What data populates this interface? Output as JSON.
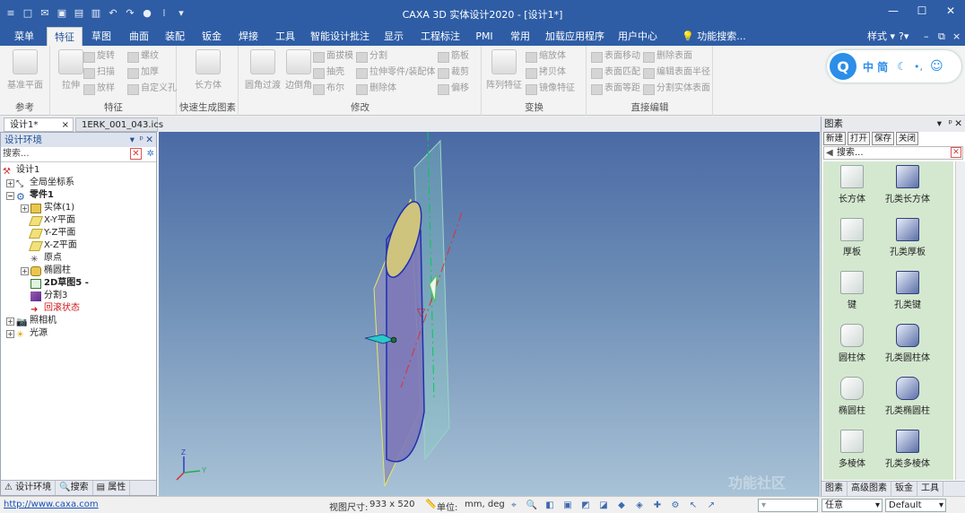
{
  "window": {
    "title": "CAXA 3D 实体设计2020 - [设计1*]"
  },
  "menu": {
    "file_label": "菜单",
    "tabs": [
      "特征",
      "草图",
      "曲面",
      "装配",
      "钣金",
      "焊接",
      "工具",
      "智能设计批注",
      "显示",
      "工程标注",
      "PMI",
      "常用",
      "加载应用程序",
      "用户中心"
    ],
    "active_tab": "特征",
    "search_placeholder": "功能搜索...",
    "style_label": "样式"
  },
  "ribbon": {
    "groups": {
      "reference": "参考",
      "feature": "特征",
      "quick": "快速生成图素",
      "modify": "修改",
      "transform": "变换",
      "direct": "直接编辑"
    },
    "buttons": {
      "base_plane": "基准平面",
      "extrude": "拉伸",
      "rotate": "旋转",
      "sweep": "扫描",
      "loft": "放样",
      "thread": "螺纹",
      "thicken": "加厚",
      "custom_hole": "自定义孔",
      "box": "长方体",
      "fillet": "圆角过渡",
      "chamfer": "边倒角",
      "face_draft": "面拔模",
      "shell": "抽壳",
      "boolean": "布尔",
      "split": "分割",
      "extrude_to_part": "拉伸零件/装配体",
      "delete_body": "删除体",
      "rib": "筋板",
      "trim": "裁剪",
      "offset": "偏移",
      "pattern": "阵列特征",
      "scale": "缩放体",
      "copy_body": "拷贝体",
      "mirror": "镜像特征",
      "face_move": "表面移动",
      "face_match": "表面匹配",
      "face_equidistant": "表面等距",
      "delete_face": "删除表面",
      "edit_face_radius": "编辑表面半径",
      "split_body_face": "分割实体表面"
    }
  },
  "assistant": {
    "letter": "Q",
    "text": "中 简"
  },
  "doc_tabs": [
    "设计1*",
    "1ERK_001_043.ics"
  ],
  "left_panel": {
    "title": "设计环境",
    "search_placeholder": "搜索...",
    "tree": [
      {
        "label": "设计1"
      },
      {
        "label": "全局坐标系"
      },
      {
        "label": "零件1"
      },
      {
        "label": "实体(1)"
      },
      {
        "label": "X-Y平面"
      },
      {
        "label": "Y-Z平面"
      },
      {
        "label": "X-Z平面"
      },
      {
        "label": "原点"
      },
      {
        "label": "椭圆柱"
      },
      {
        "label": "2D草图5 -"
      },
      {
        "label": "分割3"
      },
      {
        "label": "回滚状态"
      },
      {
        "label": "照相机"
      },
      {
        "label": "光源"
      }
    ],
    "bottom_tabs": [
      "设计环境",
      "搜索",
      "属性"
    ]
  },
  "right_panel": {
    "title": "图素",
    "tools": [
      "新建",
      "打开",
      "保存",
      "关闭"
    ],
    "search_placeholder": "搜索...",
    "items": [
      {
        "label": "长方体"
      },
      {
        "label": "孔类长方体"
      },
      {
        "label": "厚板"
      },
      {
        "label": "孔类厚板"
      },
      {
        "label": "键"
      },
      {
        "label": "孔类键"
      },
      {
        "label": "圆柱体"
      },
      {
        "label": "孔类圆柱体"
      },
      {
        "label": "椭圆柱"
      },
      {
        "label": "孔类椭圆柱"
      },
      {
        "label": "多棱体"
      },
      {
        "label": "孔类多棱体"
      }
    ],
    "bottom_tabs": [
      "图素",
      "高级图素",
      "钣金",
      "工具"
    ]
  },
  "status": {
    "url": "http://www.caxa.com",
    "view_size_label": "视图尺寸:",
    "view_size": "933 x 520",
    "unit_label": "单位:",
    "units": "mm, deg",
    "snap_mode": "任意",
    "default_label": "Default",
    "watermark": "功能社区"
  },
  "colors": {
    "accent": "#2e5da6",
    "viewport_top": "#4a6aa5",
    "viewport_bottom": "#a8c2d6",
    "gallery_bg": "#d4e8d0"
  }
}
